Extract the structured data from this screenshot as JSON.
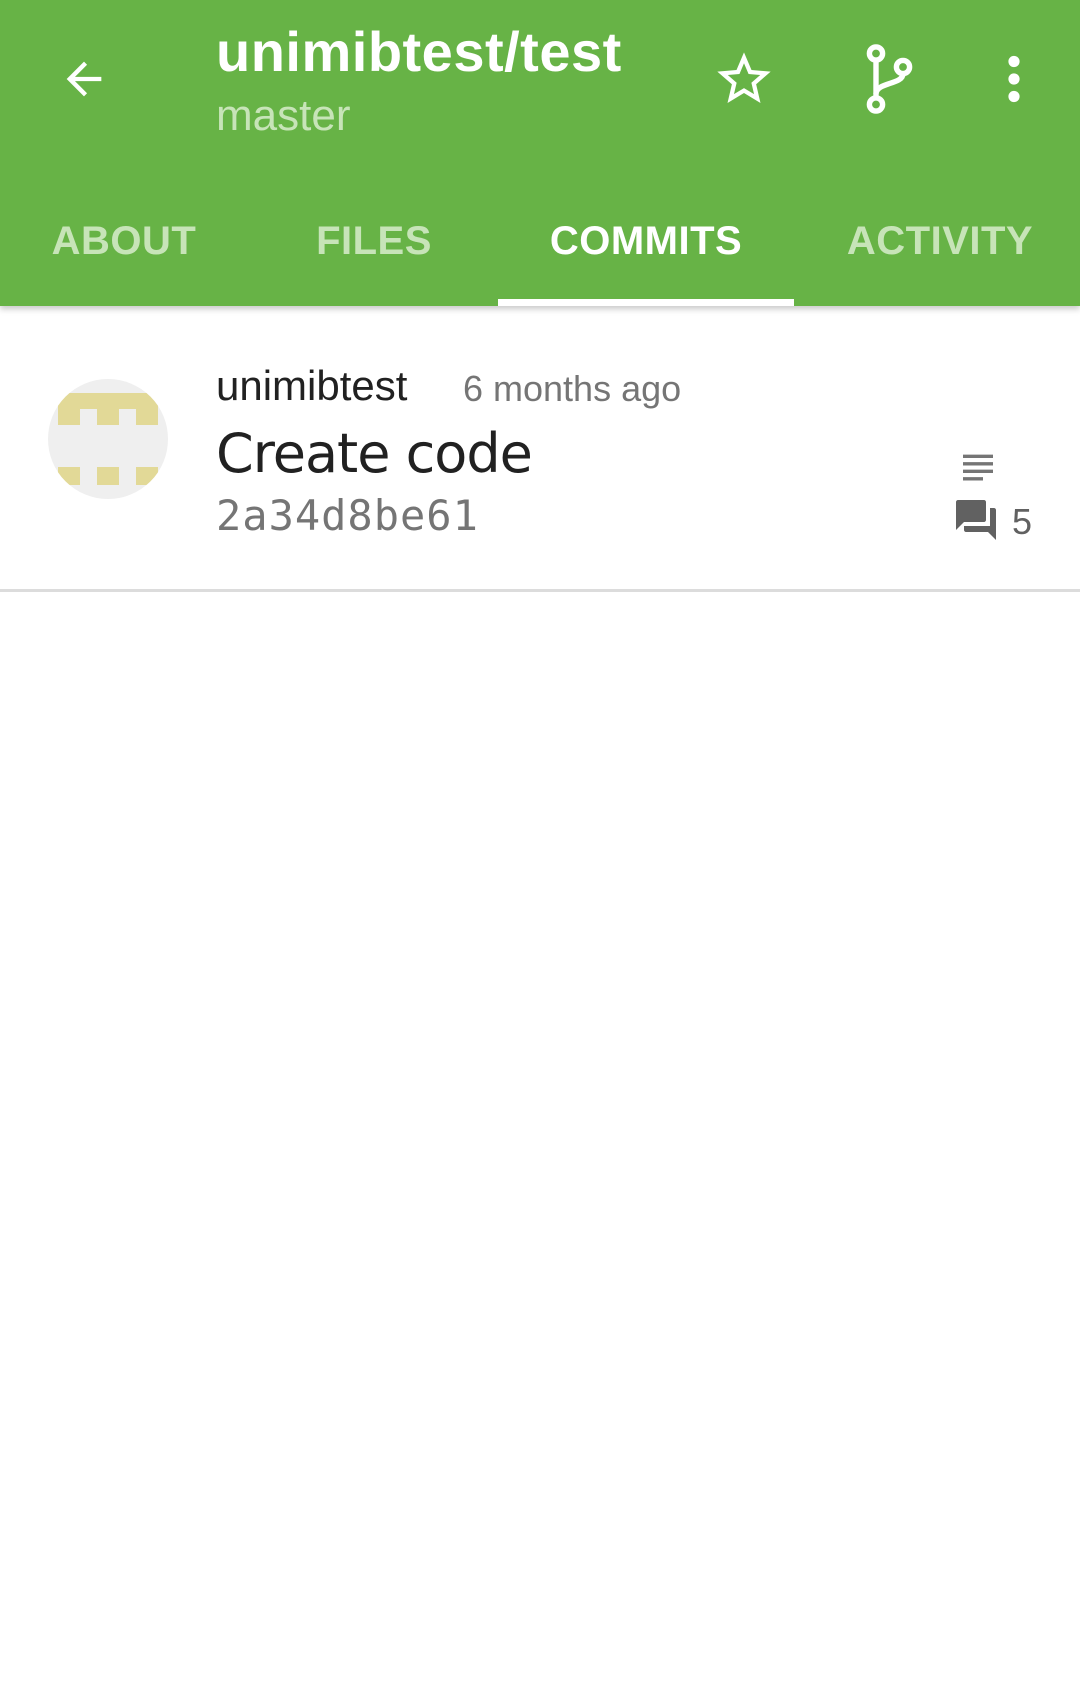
{
  "toolbar": {
    "title": "unimibtest/test",
    "subtitle": "master",
    "back_icon": "arrow-back-icon",
    "star_icon": "star-outline-icon",
    "branch_icon": "branch-icon",
    "more_icon": "more-vert-icon"
  },
  "tabs": [
    {
      "label": "ABOUT",
      "active": false
    },
    {
      "label": "FILES",
      "active": false
    },
    {
      "label": "COMMITS",
      "active": true
    },
    {
      "label": "ACTIVITY",
      "active": false
    }
  ],
  "commits": [
    {
      "author": "unimibtest",
      "time": "6 months ago",
      "message": "Create code",
      "sha": "2a34d8be61",
      "comment_count": "5",
      "has_description": true
    }
  ],
  "colors": {
    "primary": "#67b346",
    "tab_inactive": "#c7e4b8",
    "avatar_pattern": "#e2d997"
  }
}
